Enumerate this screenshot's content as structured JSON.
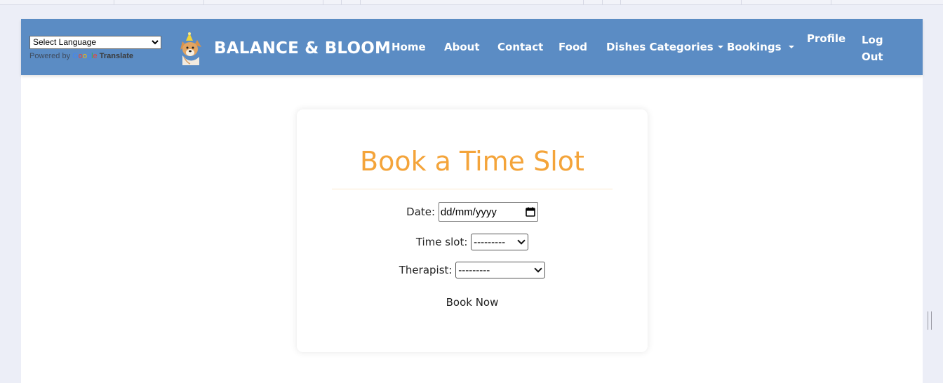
{
  "translate": {
    "select_label": "Select Language",
    "powered_by": "Powered by",
    "google_letters": [
      "G",
      "o",
      "o",
      "g",
      "l",
      "e"
    ],
    "translate_label": "Translate"
  },
  "brand": {
    "name": "BALANCE & BLOOM",
    "logo_icon": "dog-with-party-hat"
  },
  "nav": {
    "home": "Home",
    "about": "About",
    "contact": "Contact",
    "food": "Food",
    "dishes_categories": "Dishes Categories",
    "bookings": "Bookings",
    "profile": "Profile",
    "logout_line1": "Log",
    "logout_line2": "Out"
  },
  "form": {
    "title": "Book a Time Slot",
    "date_label": "Date:",
    "date_value": "dd/mm/yyyy",
    "timeslot_label": "Time slot:",
    "timeslot_value": "---------",
    "therapist_label": "Therapist:",
    "therapist_value": "---------",
    "submit_label": "Book Now"
  },
  "colors": {
    "navbar": "#5b8cc4",
    "title": "#f4a43a",
    "page_bg": "#eceef7"
  }
}
